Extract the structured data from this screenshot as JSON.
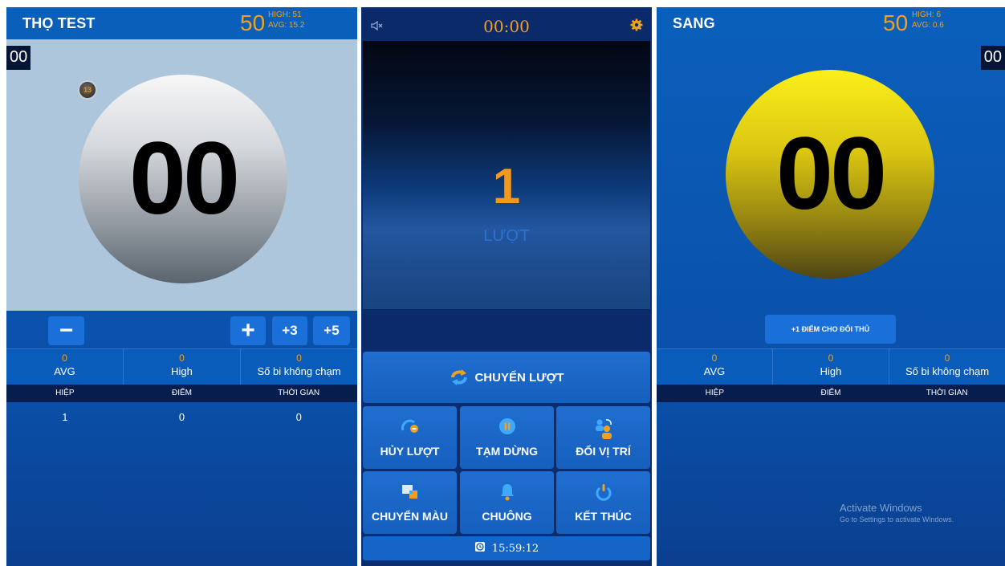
{
  "left_player": {
    "name": "THỌ TEST",
    "target": "50",
    "high": "HIGH: 51",
    "avg": "AVG: 15.2",
    "seconds": "00",
    "ball_score": "00",
    "mini_ball": "13",
    "buttons": {
      "minus": "−",
      "plus": "+",
      "plus3": "+3",
      "plus5": "+5"
    },
    "stats": [
      {
        "value": "0",
        "label": "AVG"
      },
      {
        "value": "0",
        "label": "High"
      },
      {
        "value": "0",
        "label": "Số bi không chạm"
      }
    ],
    "table_headers": [
      "HIỆP",
      "ĐIỂM",
      "THỜI GIAN"
    ],
    "rows": [
      {
        "inning": "1",
        "points": "0",
        "time": "0"
      }
    ]
  },
  "right_player": {
    "name": "SANG",
    "target": "50",
    "high": "HIGH: 6",
    "avg": "AVG: 0.6",
    "seconds": "00",
    "ball_score": "00",
    "opponent_button": "+1 ĐIỂM CHO ĐỐI THỦ",
    "stats": [
      {
        "value": "0",
        "label": "AVG"
      },
      {
        "value": "0",
        "label": "High"
      },
      {
        "value": "0",
        "label": "Số bi không chạm"
      }
    ],
    "table_headers": [
      "HIỆP",
      "ĐIỂM",
      "THỜI GIAN"
    ]
  },
  "center": {
    "timer": "00:00",
    "turn_number": "1",
    "turn_label": "LƯỢT",
    "switch_turn": "CHUYỂN LƯỢT",
    "buttons": {
      "cancel_turn": "HỦY LƯỢT",
      "pause": "TẠM DỪNG",
      "swap_position": "ĐỔI VỊ TRÍ",
      "switch_color": "CHUYỂN MÀU",
      "bell": "CHUÔNG",
      "finish": "KẾT THÚC"
    },
    "clock": "15:59:12"
  },
  "watermark": {
    "line1": "Activate Windows",
    "line2": "Go to Settings to activate Windows."
  },
  "colors": {
    "accent_orange": "#f0a020",
    "panel_blue": "#0a5fbb",
    "button_blue": "#1a6fd8",
    "dark_navy": "#061d4d"
  },
  "icons": [
    "mute-icon",
    "gear-icon",
    "switch-turn-icon",
    "undo-icon",
    "pause-icon",
    "swap-users-icon",
    "color-switch-icon",
    "bell-icon",
    "power-icon",
    "alarm-clock-icon"
  ]
}
